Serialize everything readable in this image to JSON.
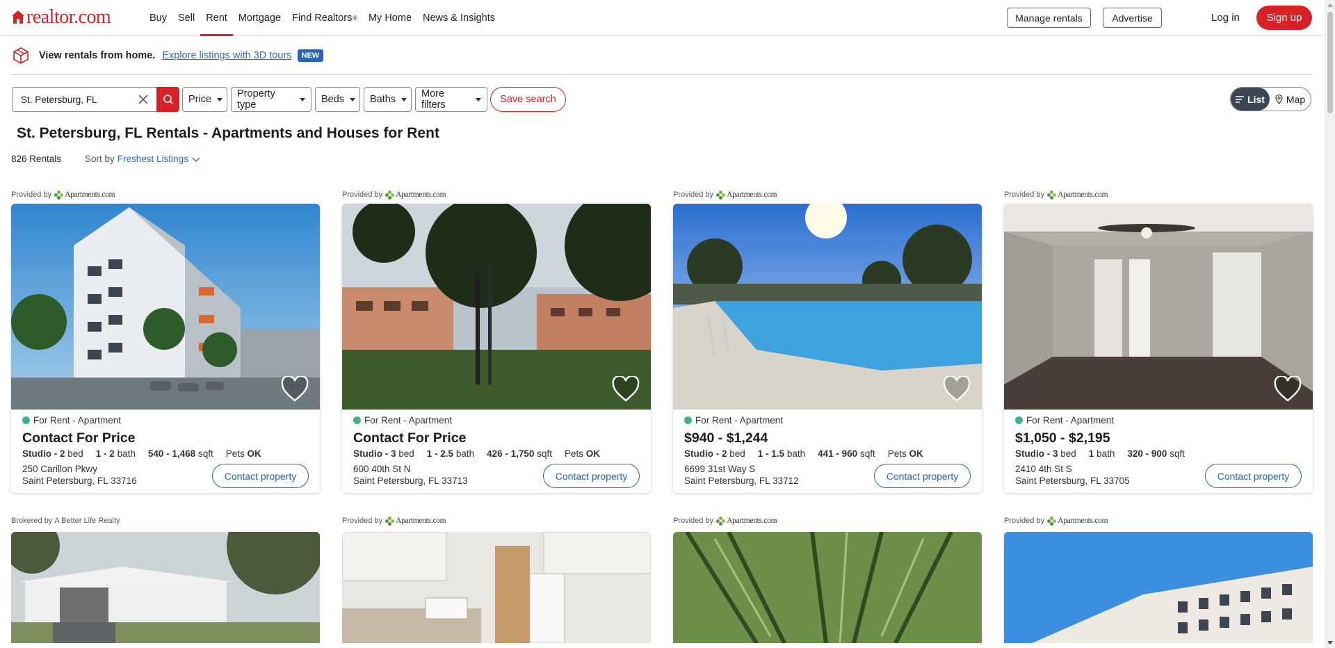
{
  "brand": {
    "logo_text": "realtor.com",
    "accent": "#d92228",
    "link_color": "#2a6fba"
  },
  "nav": {
    "items": [
      "Buy",
      "Sell",
      "Rent",
      "Mortgage",
      "Find Realtors",
      "My Home",
      "News & Insights"
    ],
    "active": "Rent",
    "find_realtors_sup": "®"
  },
  "header_actions": {
    "manage_rentals": "Manage rentals",
    "advertise": "Advertise",
    "login": "Log in",
    "signup": "Sign up"
  },
  "banner": {
    "title": "View rentals from home.",
    "link": "Explore listings with 3D tours",
    "badge": "NEW",
    "icon": "cube-icon"
  },
  "search": {
    "value": "St. Petersburg, FL",
    "clear_icon": "close-icon",
    "search_icon": "search-icon"
  },
  "filters": {
    "price": "Price",
    "property_type": "Property type",
    "beds": "Beds",
    "baths": "Baths",
    "more": "More filters",
    "save": "Save search"
  },
  "view_toggle": {
    "list": "List",
    "map": "Map",
    "selected": "List"
  },
  "page_title": "St. Petersburg, FL Rentals - Apartments and Houses for Rent",
  "results": {
    "count": "826 Rentals",
    "sort_label": "Sort by",
    "sort_value": "Freshest Listings"
  },
  "listings": [
    {
      "provider_label": "Provided by",
      "provider": "Apartments.com",
      "status": "For Rent - Apartment",
      "price": "Contact For Price",
      "beds": "Studio - 2",
      "beds_label": "bed",
      "baths": "1 - 2",
      "baths_label": "bath",
      "sqft": "540 - 1,468",
      "sqft_label": "sqft",
      "pets_label": "Pets",
      "pets": "OK",
      "street": "250 Carillon Pkwy",
      "city": "Saint Petersburg, FL 33716",
      "contact": "Contact property"
    },
    {
      "provider_label": "Provided by",
      "provider": "Apartments.com",
      "status": "For Rent - Apartment",
      "price": "Contact For Price",
      "beds": "Studio - 3",
      "beds_label": "bed",
      "baths": "1 - 2.5",
      "baths_label": "bath",
      "sqft": "426 - 1,750",
      "sqft_label": "sqft",
      "pets_label": "Pets",
      "pets": "OK",
      "street": "600 40th St N",
      "city": "Saint Petersburg, FL 33713",
      "contact": "Contact property"
    },
    {
      "provider_label": "Provided by",
      "provider": "Apartments.com",
      "status": "For Rent - Apartment",
      "price": "$940 - $1,244",
      "beds": "Studio - 2",
      "beds_label": "bed",
      "baths": "1 - 1.5",
      "baths_label": "bath",
      "sqft": "441 - 960",
      "sqft_label": "sqft",
      "pets_label": "Pets",
      "pets": "OK",
      "street": "6699 31st Way S",
      "city": "Saint Petersburg, FL 33712",
      "contact": "Contact property"
    },
    {
      "provider_label": "Provided by",
      "provider": "Apartments.com",
      "status": "For Rent - Apartment",
      "price": "$1,050 - $2,195",
      "beds": "Studio - 3",
      "beds_label": "bed",
      "baths": "1",
      "baths_label": "bath",
      "sqft": "320 - 900",
      "sqft_label": "sqft",
      "pets_label": "",
      "pets": "",
      "street": "2410 4th St S",
      "city": "Saint Petersburg, FL 33705",
      "contact": "Contact property"
    }
  ],
  "second_row_providers": [
    {
      "label": "Brokered by",
      "name": "A Better Life Realty"
    },
    {
      "label": "Provided by",
      "name": "Apartments.com"
    },
    {
      "label": "Provided by",
      "name": "Apartments.com"
    },
    {
      "label": "Provided by",
      "name": "Apartments.com"
    }
  ],
  "colors": {
    "for_rent_dot": "#3eb08f",
    "contact_border": "#2a62b8",
    "toggle_active": "#3a4654"
  }
}
